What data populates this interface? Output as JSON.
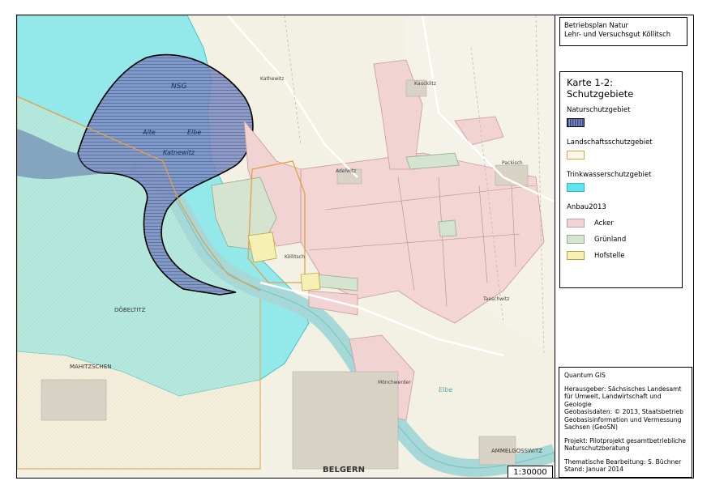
{
  "title_box": {
    "line1": "Betriebsplan Natur",
    "line2": "Lehr- und Versuchsgut Köllitsch"
  },
  "legend": {
    "title_line1": "Karte 1-2:",
    "title_line2": "Schutzgebiete",
    "nsg_label": "Naturschutzgebiet",
    "lsg_label": "Landschaftsschutzgebiet",
    "tws_label": "Trinkwasserschutzgebiet",
    "anbau_label": "Anbau2013",
    "items": [
      {
        "label": "Acker",
        "color": "#f2d3d3"
      },
      {
        "label": "Grünland",
        "color": "#d5e4cf"
      },
      {
        "label": "Hofstelle",
        "color": "#f7f0b5"
      }
    ],
    "colors": {
      "nsg": "#5e6fa8",
      "lsg_border": "#e2a04a",
      "tws": "#5fe3ec"
    }
  },
  "info": {
    "software": "Quantum GIS",
    "publisher": "Herausgeber: Sächsisches Landesamt für Umwelt, Landwirtschaft und Geologie",
    "geodata": "Geobasisdaten: © 2013, Staatsbetrieb Geobasisinformation und Vermessung Sachsen (GeoSN)",
    "project": "Projekt: Pilotprojekt gesamtbetriebliche Naturschutzberatung",
    "author": "Thematische Bearbeitung: S. Büchner",
    "date": "Stand: Januar 2014"
  },
  "scale": "1:30000",
  "map_labels": {
    "nsg": "NSG",
    "alte_elbe": "Alte",
    "elbe": "Elbe",
    "katnewitz": "Katnewitz",
    "kathewitz": "Kathewitz",
    "doebeltitz": "DÖBELTITZ",
    "mahitzschen": "MAHITZSCHEN",
    "belgern": "BELGERN",
    "ammelgosswitz": "AMMELGOSSWITZ",
    "packisch": "Packisch",
    "kaucklitz": "Kaucklitz",
    "adelwitz": "Adelwitz",
    "koellitsch": "Köllitsch",
    "taeschwitz": "Taeschwitz",
    "moenchwerder": "Mönchwerder",
    "elbe_river": "Elbe"
  }
}
